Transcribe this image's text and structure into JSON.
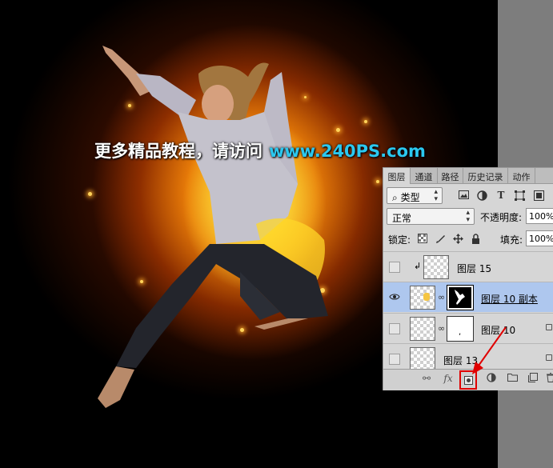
{
  "watermark": {
    "cn": "更多精品教程，请访问",
    "url": "www.240PS.com"
  },
  "panel": {
    "tabs": [
      "图层",
      "通道",
      "路径",
      "历史记录",
      "动作",
      ""
    ],
    "filter": {
      "search_icon": "⌕",
      "kind_label": "类型"
    },
    "filter_icons": [
      "image-filter-icon",
      "adjustment-filter-icon",
      "type-filter-icon",
      "shape-filter-icon",
      "smart-object-filter-icon"
    ],
    "blend_mode": "正常",
    "opacity_label": "不透明度:",
    "opacity_value": "100%",
    "lock_label": "锁定:",
    "fill_label": "填充:",
    "fill_value": "100%",
    "layers": [
      {
        "name": "图层 15",
        "visible": false,
        "clipped": true,
        "has_mask": false,
        "selected": false
      },
      {
        "name": "图层 10 副本",
        "visible": true,
        "clipped": false,
        "has_mask": true,
        "selected": true
      },
      {
        "name": "图层 10",
        "visible": false,
        "clipped": false,
        "has_mask": true,
        "selected": false
      },
      {
        "name": "图层 13",
        "visible": false,
        "clipped": false,
        "has_mask": false,
        "selected": false
      }
    ],
    "bottom_buttons": [
      "link-layers",
      "fx",
      "add-layer-mask",
      "adjustment-layer",
      "new-group",
      "new-layer",
      "delete-layer"
    ],
    "fx_label": "fx"
  },
  "colors": {
    "highlight": "#aec7ee",
    "annotation_red": "#e00000",
    "url_blue": "#2bc8f0"
  }
}
